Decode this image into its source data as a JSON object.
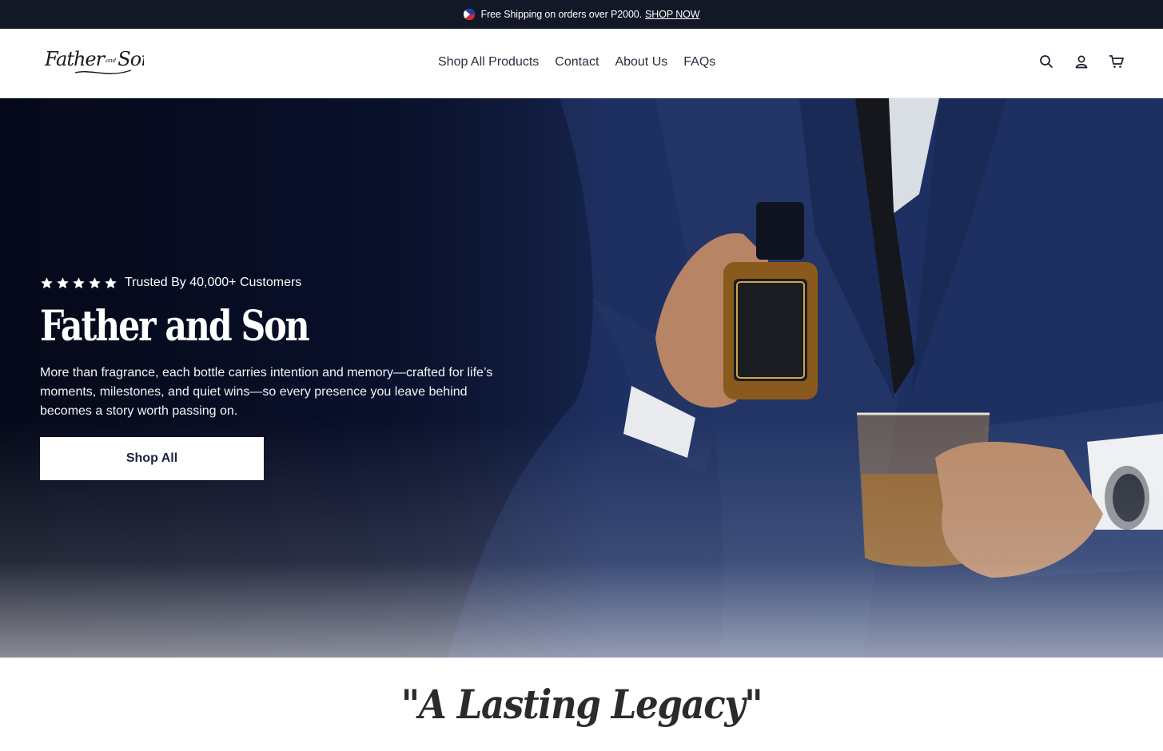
{
  "announcement": {
    "text": "Free Shipping on orders over P2000.",
    "link_label": "SHOP NOW",
    "flag_icon": "philippines-flag-icon"
  },
  "header": {
    "logo_text": "Father",
    "logo_and": "and",
    "logo_son": "Son",
    "nav": [
      {
        "label": "Shop All Products"
      },
      {
        "label": "Contact"
      },
      {
        "label": "About Us"
      },
      {
        "label": "FAQs"
      }
    ],
    "icons": [
      "search-icon",
      "account-icon",
      "cart-icon"
    ]
  },
  "hero": {
    "rating_stars": 5,
    "rating_text": "Trusted By 40,000+ Customers",
    "title": "Father and Son",
    "description": "More than fragrance, each bottle carries intention and memory—crafted for life’s moments, milestones, and quiet wins—so every presence you leave behind becomes a story worth passing on.",
    "cta_label": "Shop All",
    "image_subject": "man in navy suit holding perfume bottle and whiskey glass"
  },
  "section": {
    "headline": "\"A Lasting Legacy\""
  },
  "colors": {
    "announcement_bg": "#121826",
    "hero_dark": "#0b1330",
    "suit_navy": "#1f3262",
    "button_text": "#1b2340"
  }
}
